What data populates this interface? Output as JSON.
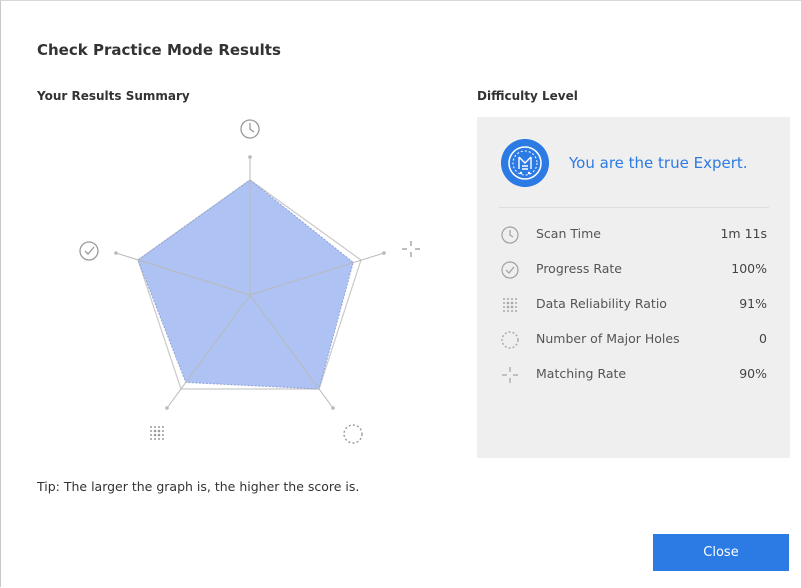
{
  "dialog": {
    "title": "Check Practice Mode Results",
    "close_label": "Close",
    "tip": "Tip: The larger the graph is, the higher the score is."
  },
  "summary": {
    "title": "Your Results Summary",
    "radar": {
      "axes": [
        {
          "name": "Scan Time",
          "icon": "clock-icon",
          "score": 1.0
        },
        {
          "name": "Matching Rate",
          "icon": "crosshair-icon",
          "score": 0.93
        },
        {
          "name": "Number of Major Holes",
          "icon": "dotted-circle-icon",
          "score": 1.0
        },
        {
          "name": "Data Reliability Ratio",
          "icon": "dot-grid-icon",
          "score": 0.93
        },
        {
          "name": "Progress Rate",
          "icon": "check-circle-icon",
          "score": 1.0
        }
      ]
    }
  },
  "difficulty": {
    "title": "Difficulty Level",
    "level_text": "You are the true Expert.",
    "badge_icon": "expert-badge-icon",
    "metrics": [
      {
        "label": "Scan Time",
        "value": "1m 11s",
        "icon": "clock-icon"
      },
      {
        "label": "Progress Rate",
        "value": "100%",
        "icon": "check-circle-icon"
      },
      {
        "label": "Data Reliability Ratio",
        "value": "91%",
        "icon": "dot-grid-icon"
      },
      {
        "label": "Number of Major Holes",
        "value": "0",
        "icon": "dotted-circle-icon"
      },
      {
        "label": "Matching Rate",
        "value": "90%",
        "icon": "crosshair-icon"
      }
    ]
  },
  "colors": {
    "accent": "#2c7be5",
    "radar_fill": "#a7bdf2",
    "panel_bg": "#efefef"
  }
}
